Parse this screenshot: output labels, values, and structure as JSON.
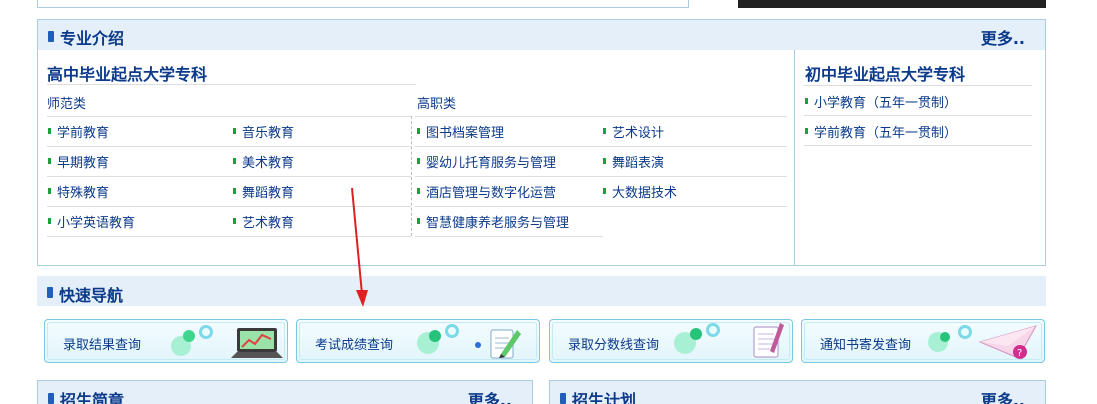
{
  "major_intro": {
    "title": "专业介绍",
    "more": "更多..",
    "senior": {
      "title": "高中毕业起点大学专科",
      "normal": {
        "label": "师范类",
        "col1": [
          "学前教育",
          "早期教育",
          "特殊教育",
          "小学英语教育"
        ],
        "col2": [
          "音乐教育",
          "美术教育",
          "舞蹈教育",
          "艺术教育"
        ]
      },
      "vocational": {
        "label": "高职类",
        "col1": [
          "图书档案管理",
          "婴幼儿托育服务与管理",
          "酒店管理与数字化运营",
          "智慧健康养老服务与管理"
        ],
        "col2": [
          "艺术设计",
          "舞蹈表演",
          "大数据技术"
        ]
      }
    },
    "junior": {
      "title": "初中毕业起点大学专科",
      "items": [
        "小学教育（五年一贯制）",
        "学前教育（五年一贯制）"
      ]
    }
  },
  "quick_nav": {
    "title": "快速导航",
    "buttons": [
      {
        "label": "录取结果查询",
        "icon": "laptop-icon"
      },
      {
        "label": "考试成绩查询",
        "icon": "pen-paper-icon"
      },
      {
        "label": "录取分数线查询",
        "icon": "notebook-icon"
      },
      {
        "label": "通知书寄发查询",
        "icon": "paper-plane-icon"
      }
    ]
  },
  "admission_guide": {
    "title": "招生简章",
    "more": "更多.."
  },
  "enrollment_plan": {
    "title": "招生计划",
    "more": "更多.."
  },
  "colors": {
    "accent": "#0b3a8a",
    "header_bg": "#e4effa",
    "bullet": "#17a33a",
    "arrow": "#e02020"
  }
}
